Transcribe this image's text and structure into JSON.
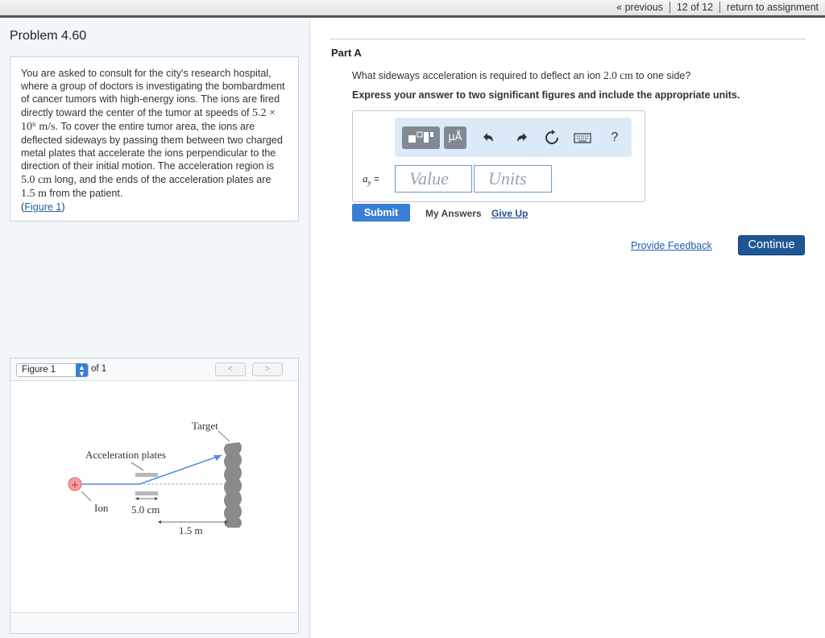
{
  "nav": {
    "previous": "« previous",
    "position": "12 of 12",
    "return": "return to assignment"
  },
  "problem": {
    "title": "Problem 4.60",
    "text_1": "You are asked to consult for the city's research hospital, where a group of doctors is investigating the bombardment of cancer tumors with high-energy ions. The ions are fired directly toward the center of the tumor at speeds of ",
    "speed": "5.2 × 10⁶ m/s",
    "text_2": ". To cover the entire tumor area, the ions are deflected sideways by passing them between two charged metal plates that accelerate the ions perpendicular to the direction of their initial motion. The acceleration region is ",
    "region_length": "5.0 cm",
    "text_3": " long, and the ends of the acceleration plates are ",
    "distance": "1.5 m",
    "text_4": " from the patient.",
    "figure_link": "Figure 1",
    "paren_open": "(",
    "paren_close": ")"
  },
  "figure": {
    "select_value": "Figure 1",
    "of_label": "of 1",
    "prev_btn": "<",
    "next_btn": ">",
    "labels": {
      "target": "Target",
      "plates": "Acceleration plates",
      "ion": "Ion",
      "plate_length": "5.0 cm",
      "distance": "1.5 m",
      "ion_sign": "+"
    }
  },
  "part": {
    "label": "Part A",
    "question_1": "What sideways acceleration is required to deflect an ion ",
    "question_value": "2.0 cm",
    "question_2": " to one side?",
    "instruction": "Express your answer to two significant figures and include the appropriate units."
  },
  "answer": {
    "variable": "a",
    "variable_sub": "y",
    "equals": " =",
    "value_placeholder": "Value",
    "units_placeholder": "Units",
    "mu_label": "μÅ",
    "help_label": "?"
  },
  "actions": {
    "submit": "Submit",
    "my_answers": "My Answers",
    "give_up": "Give Up",
    "feedback": "Provide Feedback",
    "continue": "Continue"
  },
  "colors": {
    "accent": "#3a7fd5",
    "continue": "#1f5795",
    "toolbar_bg": "#dceaf8"
  },
  "icons": [
    "templates-icon",
    "units-icon",
    "undo-icon",
    "redo-icon",
    "reset-icon",
    "keyboard-icon",
    "help-icon"
  ]
}
